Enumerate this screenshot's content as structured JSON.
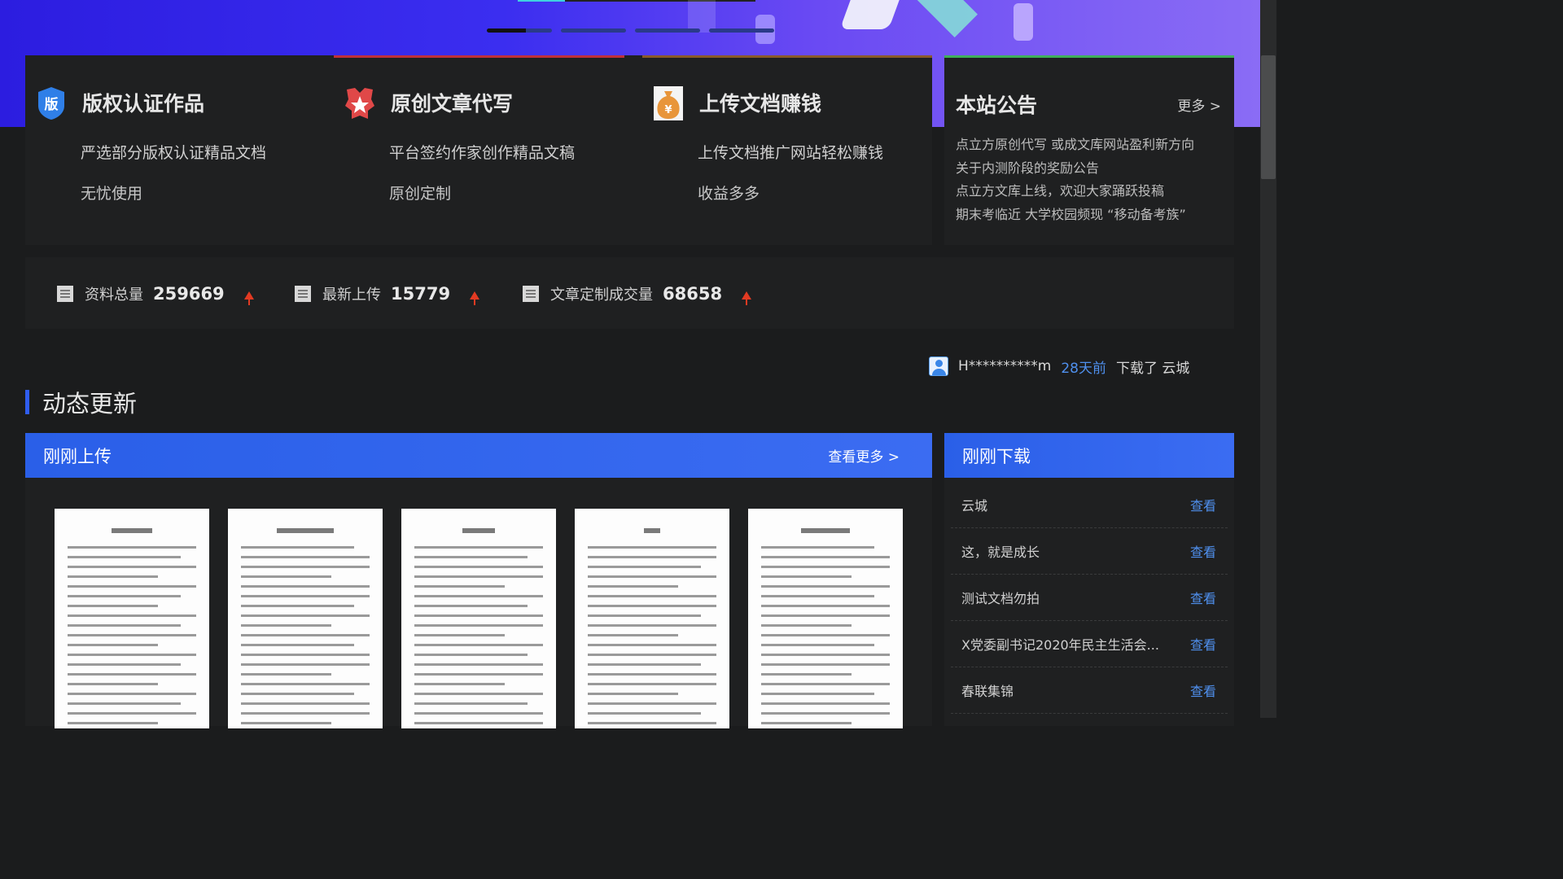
{
  "features": [
    {
      "icon": "copyright-badge-icon",
      "icon_text": "版",
      "title": "版权认证作品",
      "desc1": "严选部分版权认证精品文档",
      "desc2": "无忧使用",
      "accent": "#2f5df0"
    },
    {
      "icon": "star-award-icon",
      "title": "原创文章代写",
      "desc1": "平台签约作家创作精品文稿",
      "desc2": "原创定制",
      "accent": "#d83a3a"
    },
    {
      "icon": "money-bag-icon",
      "icon_text": "¥",
      "title": "上传文档赚钱",
      "desc1": "上传文档推广网站轻松赚钱",
      "desc2": "收益多多",
      "accent": "#e8953a"
    }
  ],
  "notice": {
    "title": "本站公告",
    "more": "更多 >",
    "items": [
      "点立方原创代写 或成文库网站盈利新方向",
      "关于内测阶段的奖励公告",
      "点立方文库上线，欢迎大家踊跃投稿",
      "期末考临近 大学校园频现 “移动备考族”"
    ]
  },
  "stats": [
    {
      "icon": "document-icon",
      "label": "资料总量",
      "value": "259669"
    },
    {
      "icon": "document-icon",
      "label": "最新上传",
      "value": "15779"
    },
    {
      "icon": "document-icon",
      "label": "文章定制成交量",
      "value": "68658"
    }
  ],
  "ticker": {
    "user": "H**********m",
    "time": "28天前",
    "action": "下载了 云城"
  },
  "section": {
    "title": "动态更新"
  },
  "uploads": {
    "title": "刚刚上传",
    "more": "查看更多 >"
  },
  "downloads": {
    "title": "刚刚下载",
    "items": [
      {
        "name": "云城",
        "action": "查看"
      },
      {
        "name": "这，就是成长",
        "action": "查看"
      },
      {
        "name": "测试文档勿拍",
        "action": "查看"
      },
      {
        "name": "X党委副书记2020年民主生活会...",
        "action": "查看"
      },
      {
        "name": "春联集锦",
        "action": "查看"
      }
    ]
  },
  "colors": {
    "accent_blue": "#2f5df0",
    "link_blue": "#4f90ee",
    "up_arrow": "#e23a22"
  }
}
